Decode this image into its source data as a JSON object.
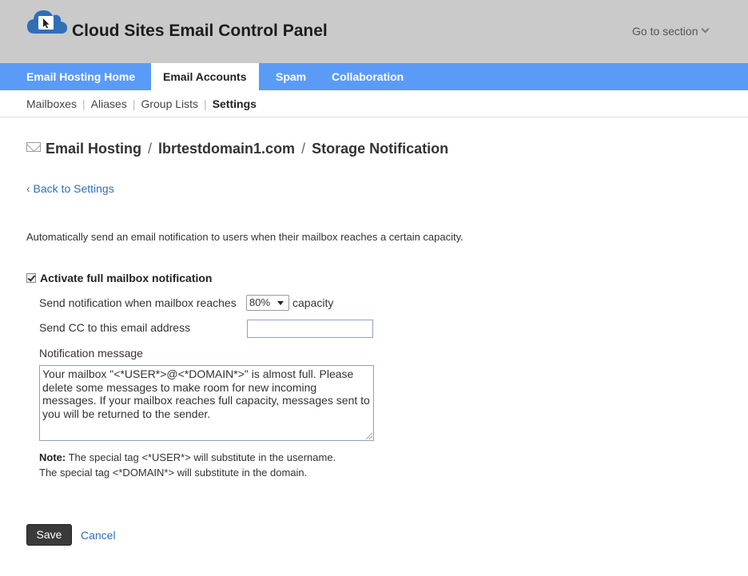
{
  "app": {
    "title": "Cloud Sites Email Control Panel",
    "goto_section": "Go to section",
    "brand_color": "#5b9bf8",
    "logo_icon": "cloud-cursor-icon"
  },
  "main_nav": {
    "tabs": [
      {
        "label": "Email Hosting Home",
        "active": false
      },
      {
        "label": "Email Accounts",
        "active": true
      },
      {
        "label": "Spam",
        "active": false
      },
      {
        "label": "Collaboration",
        "active": false
      }
    ]
  },
  "sub_nav": {
    "items": [
      {
        "label": "Mailboxes",
        "active": false
      },
      {
        "label": "Aliases",
        "active": false
      },
      {
        "label": "Group Lists",
        "active": false
      },
      {
        "label": "Settings",
        "active": true
      }
    ],
    "separator": "|"
  },
  "breadcrumb": {
    "icon": "envelope-icon",
    "items": [
      "Email Hosting",
      "lbrtestdomain1.com",
      "Storage Notification"
    ],
    "separator": "/"
  },
  "back_link": "‹ Back to Settings",
  "description": "Automatically send an email notification to users when their mailbox reaches a certain capacity.",
  "form": {
    "activate_label": "Activate full mailbox notification",
    "activate_checked": true,
    "threshold_label": "Send notification when mailbox reaches",
    "threshold_value": "80%",
    "threshold_suffix": "capacity",
    "cc_label": "Send CC to this email address",
    "cc_value": "",
    "message_label": "Notification message",
    "message_value": "Your mailbox \"<*USER*>@<*DOMAIN*>\" is almost full. Please delete some messages to make room for new incoming messages. If your mailbox reaches full capacity, messages sent to you will be returned to the sender.",
    "note_prefix": "Note:",
    "note_line1": "The special tag <*USER*> will substitute in the username.",
    "note_line2": "The special tag <*DOMAIN*> will substitute in the domain."
  },
  "actions": {
    "save": "Save",
    "cancel": "Cancel"
  }
}
